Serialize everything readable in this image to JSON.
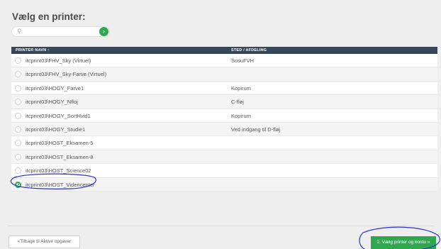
{
  "header": {
    "title": "Vælg en printer:"
  },
  "search": {
    "placeholder": "",
    "go_label": "›"
  },
  "table": {
    "columns": {
      "name": "PRINTER NAVN ↑",
      "location": "STED / AFDELING"
    },
    "rows": [
      {
        "name": "itcprint03\\FHV_Sky (Virtuel)",
        "location": "SosuFVH",
        "selected": false
      },
      {
        "name": "itcprint03\\FHV_Sky-Farve (Virtuel)",
        "location": "",
        "selected": false
      },
      {
        "name": "itcprint03\\HOGY_Farve1",
        "location": "Kopirum",
        "selected": false
      },
      {
        "name": "itcprint03\\HOGY_Nfloj",
        "location": "C-fløj",
        "selected": false
      },
      {
        "name": "itcprint03\\HOGY_SortHvid1",
        "location": "Kopirum",
        "selected": false
      },
      {
        "name": "itcprint03\\HOGY_Studie1",
        "location": "Ved indgang til D-fløj",
        "selected": false
      },
      {
        "name": "itcprint03\\HOST_Eksamen-5",
        "location": "",
        "selected": false
      },
      {
        "name": "itcprint03\\HOST_Eksamen-8",
        "location": "",
        "selected": false
      },
      {
        "name": "itcprint03\\HOST_Science02",
        "location": "",
        "selected": false
      },
      {
        "name": "itcprint03\\HOST_Videncenter",
        "location": "",
        "selected": true
      }
    ]
  },
  "footer": {
    "back_label": "«Tilbage til Aktive opgaver",
    "next_label": "2. Vælg printer og konto »"
  },
  "colors": {
    "accent": "#2fa84f",
    "header_bg": "#38465a",
    "annotation": "#2d2fd6"
  }
}
